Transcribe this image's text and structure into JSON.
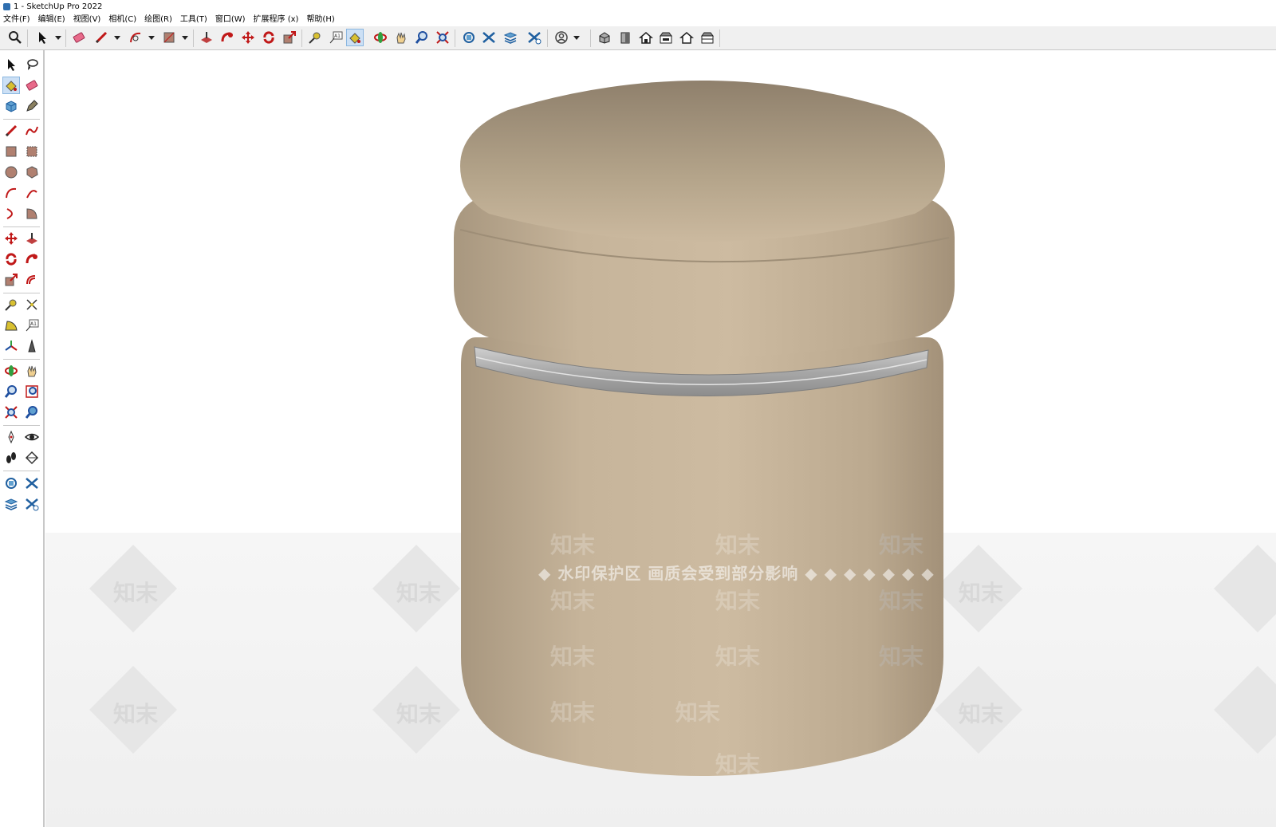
{
  "window": {
    "title": "1 - SketchUp Pro 2022"
  },
  "menu": [
    "文件(F)",
    "编辑(E)",
    "视图(V)",
    "相机(C)",
    "绘图(R)",
    "工具(T)",
    "窗口(W)",
    "扩展程序 (x)",
    "帮助(H)"
  ],
  "watermark": {
    "text": "◆ 水印保护区  画质会受到部分影响 ◆ ◆ ◆ ◆ ◆ ◆ ◆",
    "tile": "知末"
  },
  "colors": {
    "stool": "#c9b59b",
    "band": "#b8b8b8",
    "floor": "#f3f3f3"
  }
}
